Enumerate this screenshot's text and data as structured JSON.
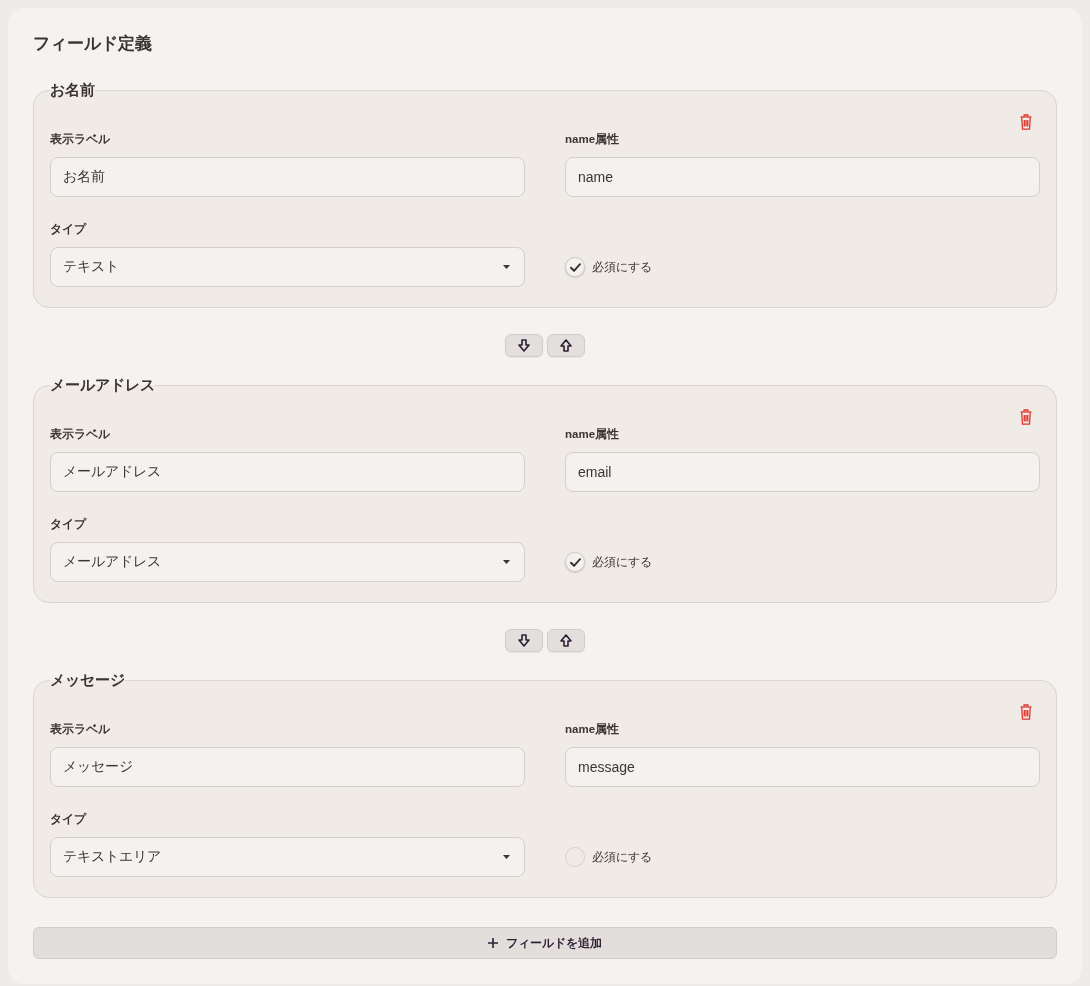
{
  "title": "フィールド定義",
  "fields": [
    {
      "legend": "お名前",
      "label_caption": "表示ラベル",
      "label_value": "お名前",
      "name_caption": "name属性",
      "name_value": "name",
      "type_caption": "タイプ",
      "type_value": "テキスト",
      "required_label": "必須にする",
      "required": true,
      "reorder_controls": true
    },
    {
      "legend": "メールアドレス",
      "label_caption": "表示ラベル",
      "label_value": "メールアドレス",
      "name_caption": "name属性",
      "name_value": "email",
      "type_caption": "タイプ",
      "type_value": "メールアドレス",
      "required_label": "必須にする",
      "required": true,
      "reorder_controls": true
    },
    {
      "legend": "メッセージ",
      "label_caption": "表示ラベル",
      "label_value": "メッセージ",
      "name_caption": "name属性",
      "name_value": "message",
      "type_caption": "タイプ",
      "type_value": "テキストエリア",
      "required_label": "必須にする",
      "required": false,
      "reorder_controls": false
    }
  ],
  "add_button": {
    "label": "フィールドを追加"
  }
}
